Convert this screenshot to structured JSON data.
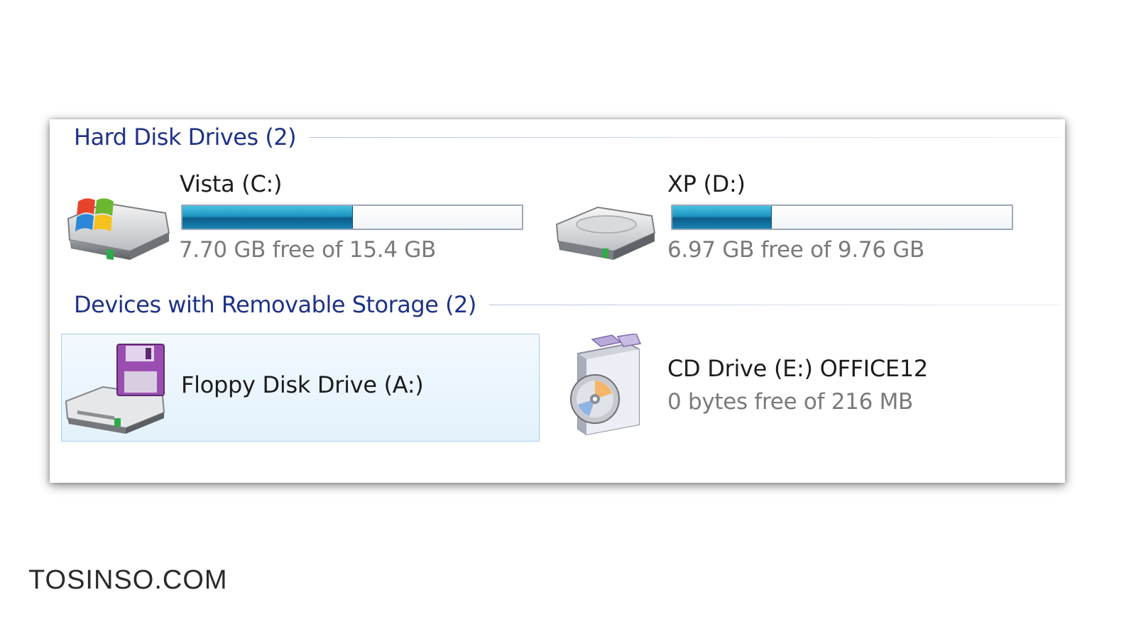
{
  "groups": {
    "hard_disks": {
      "title": "Hard Disk Drives (2)"
    },
    "removable": {
      "title": "Devices with Removable Storage (2)"
    }
  },
  "drives": {
    "c": {
      "name": "Vista (C:)",
      "free_text": "7.70 GB free of 15.4 GB",
      "used_fraction": 0.5,
      "icon": "windows-hard-drive-icon"
    },
    "d": {
      "name": "XP (D:)",
      "free_text": "6.97 GB free of 9.76 GB",
      "used_fraction": 0.29,
      "icon": "hard-drive-icon"
    },
    "a": {
      "name": "Floppy Disk Drive (A:)",
      "icon": "floppy-drive-icon",
      "selected": true
    },
    "e": {
      "name": "CD Drive (E:) OFFICE12",
      "free_text": "0 bytes free of 216 MB",
      "icon": "cd-drive-icon"
    }
  },
  "colors": {
    "group_title": "#1e3287",
    "bar_fill": "#1e93bf",
    "selection": "#e3f1fc"
  },
  "watermark": "TOSINSO.COM"
}
